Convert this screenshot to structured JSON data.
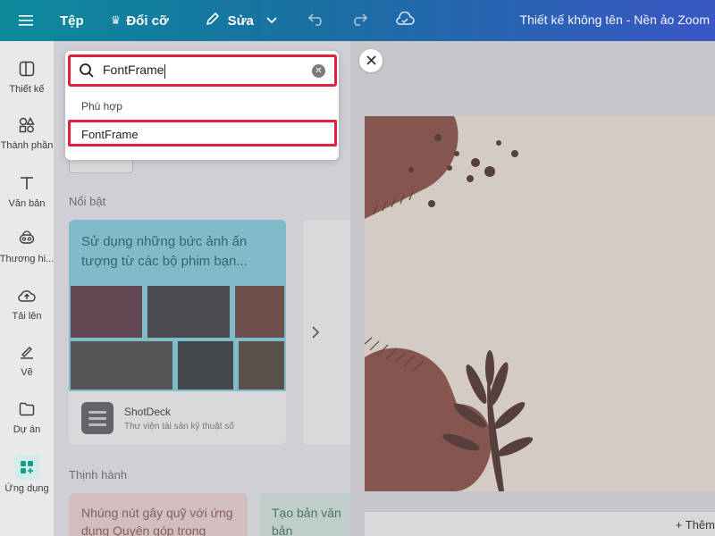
{
  "topbar": {
    "file": "Tệp",
    "resize": "Đổi cỡ",
    "edit": "Sửa",
    "title": "Thiết kế không tên - Nền ảo Zoom"
  },
  "rail": [
    {
      "label": "Thiết kế",
      "icon": "layout-icon"
    },
    {
      "label": "Thành phần",
      "icon": "elements-icon"
    },
    {
      "label": "Văn bản",
      "icon": "text-icon"
    },
    {
      "label": "Thương hi...",
      "icon": "brand-icon"
    },
    {
      "label": "Tải lên",
      "icon": "upload-icon"
    },
    {
      "label": "Vẽ",
      "icon": "draw-icon"
    },
    {
      "label": "Dự án",
      "icon": "folder-icon"
    },
    {
      "label": "Ứng dụng",
      "icon": "apps-icon"
    }
  ],
  "search": {
    "value": "FontFrame"
  },
  "dropdown": {
    "heading": "Phù hợp",
    "result": "FontFrame"
  },
  "panel": {
    "featured_title": "Nổi bật",
    "featured_card_text": "Sử dụng những bức ảnh ấn tượng từ các bộ phim bạn...",
    "app_name": "ShotDeck",
    "app_desc": "Thư viện tài sản kỹ thuật số",
    "trending_title": "Thịnh hành",
    "trend1_text": "Nhúng nút gây quỹ với ứng dụng Quyên góp trong",
    "trend2_text": "Tạo bản văn bản"
  },
  "canvas": {
    "add_page": "+ Thêm"
  },
  "colors": {
    "highlight": "#e0203f",
    "active_rail": "#1a9c8c"
  }
}
